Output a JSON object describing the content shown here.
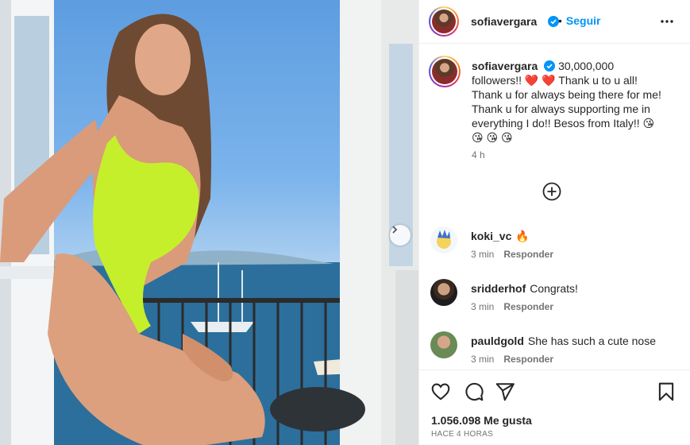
{
  "post": {
    "username": "sofiavergara",
    "follow_label": "Seguir",
    "separator": "•",
    "caption_username": "sofiavergara",
    "caption_text": "30,000,000 followers!! ❤️ ❤️ Thank u to u all! Thank u for always being there for me! Thank u for always supporting me in everything I do!! Besos from Italy!! 😘 😘 😘 😘",
    "caption_time": "4 h",
    "likes": "1.056.098 Me gusta",
    "posted_ago": "HACE 4 HORAS"
  },
  "comments": [
    {
      "user": "koki_vc",
      "text": "🔥",
      "time": "3 min",
      "reply": "Responder"
    },
    {
      "user": "sridderhof",
      "text": "Congrats!",
      "time": "3 min",
      "reply": "Responder"
    },
    {
      "user": "pauldgold",
      "text": "She has such a cute nose",
      "time": "3 min",
      "reply": "Responder"
    }
  ],
  "icons": {
    "verified": "verified-badge-icon",
    "more": "more-options-icon",
    "load_more": "plus-circle-icon",
    "like": "heart-icon",
    "comment": "comment-icon",
    "share": "send-icon",
    "save": "bookmark-icon",
    "next": "chevron-right-icon"
  },
  "colors": {
    "accent": "#0095f6",
    "text": "#262626",
    "muted": "#737373",
    "verified": "#0095f6"
  }
}
